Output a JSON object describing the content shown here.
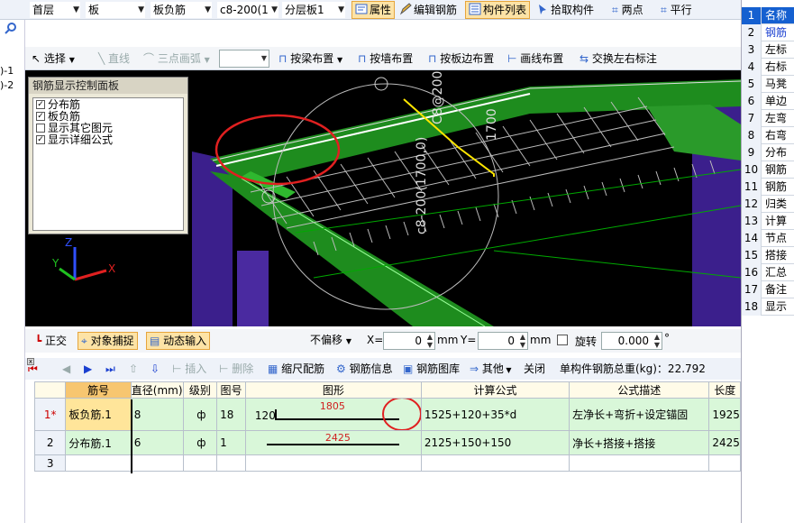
{
  "toolbar1": {
    "floor": "首层",
    "category": "板",
    "component_type": "板负筋",
    "component": "c8-200(1",
    "layer": "分层板1",
    "attr_btn": "属性",
    "edit_rebar_btn": "编辑钢筋",
    "list_btn": "构件列表",
    "pick_btn": "拾取构件",
    "twopoint_btn": "两点",
    "parallel_btn": "平行"
  },
  "left_strip": {
    "line1": ")-1",
    "line2": ")-2"
  },
  "toolbar2": {
    "select": "选择",
    "line": "直线",
    "arc": "三点画弧",
    "by_beam": "按梁布置",
    "by_wall": "按墙布置",
    "by_edge": "按板边布置",
    "draw_line": "画线布置",
    "swap_label": "交换左右标注"
  },
  "panel": {
    "title": "钢筋显示控制面板",
    "items": [
      {
        "label": "分布筋",
        "checked": true
      },
      {
        "label": "板负筋",
        "checked": true
      },
      {
        "label": "显示其它图元",
        "checked": false
      },
      {
        "label": "显示详细公式",
        "checked": true
      }
    ]
  },
  "view_labels": {
    "rebar_text": "c8-200(1700,0)",
    "rebar_text_b": "C8@200",
    "length_text": "1700",
    "axis_x": "X",
    "axis_y": "Y",
    "axis_z": "Z"
  },
  "toolbar3": {
    "ortho": "正交",
    "snap": "对象捕捉",
    "dynamic": "动态输入",
    "offset": "不偏移",
    "x_label": "X=",
    "x_value": "0",
    "mm1": "mm",
    "y_label": "Y=",
    "y_value": "0",
    "mm2": "mm",
    "rotate": "旋转",
    "rotate_value": "0.000",
    "degree": "°"
  },
  "toolbar4": {
    "insert": "插入",
    "delete": "删除",
    "scale_rebar": "缩尺配筋",
    "rebar_info": "钢筋信息",
    "rebar_lib": "钢筋图库",
    "other": "其他",
    "close": "关闭",
    "total_weight": "单构件钢筋总重(kg)：22.792"
  },
  "table": {
    "headers": [
      "筋号",
      "直径(mm)",
      "级别",
      "图号",
      "图形",
      "计算公式",
      "公式描述",
      "长度"
    ],
    "rows": [
      {
        "rn": "1*",
        "name": "板负筋.1",
        "dia": "8",
        "grade": "ф",
        "fig": "18",
        "shape_pre": "120",
        "shape_val": "1805",
        "formula": "1525+120+35*d",
        "desc": "左净长+弯折+设定锚固",
        "len": "1925"
      },
      {
        "rn": "2",
        "name": "分布筋.1",
        "dia": "6",
        "grade": "ф",
        "fig": "1",
        "shape_pre": "",
        "shape_val": "2425",
        "formula": "2125+150+150",
        "desc": "净长+搭接+搭接",
        "len": "2425"
      },
      {
        "rn": "3",
        "name": "",
        "dia": "",
        "grade": "",
        "fig": "",
        "shape_pre": "",
        "shape_val": "",
        "formula": "",
        "desc": "",
        "len": ""
      }
    ]
  },
  "right_panel": {
    "rows": [
      {
        "n": "1",
        "t": "名称"
      },
      {
        "n": "2",
        "t": "钢筋"
      },
      {
        "n": "3",
        "t": "左标"
      },
      {
        "n": "4",
        "t": "右标"
      },
      {
        "n": "5",
        "t": "马凳"
      },
      {
        "n": "6",
        "t": "单边"
      },
      {
        "n": "7",
        "t": "左弯"
      },
      {
        "n": "8",
        "t": "右弯"
      },
      {
        "n": "9",
        "t": "分布"
      },
      {
        "n": "10",
        "t": "钢筋"
      },
      {
        "n": "11",
        "t": "钢筋"
      },
      {
        "n": "12",
        "t": "归类"
      },
      {
        "n": "13",
        "t": "计算"
      },
      {
        "n": "14",
        "t": "节点"
      },
      {
        "n": "15",
        "t": "搭接"
      },
      {
        "n": "16",
        "t": "汇总"
      },
      {
        "n": "17",
        "t": "备注"
      },
      {
        "n": "18",
        "t": "显示"
      }
    ]
  },
  "colors": {
    "highlight_circle": "#e02020",
    "beam_green": "#1e8c1e",
    "column_purple": "#3b1f8c",
    "selected_row": "#d9f7d9"
  }
}
